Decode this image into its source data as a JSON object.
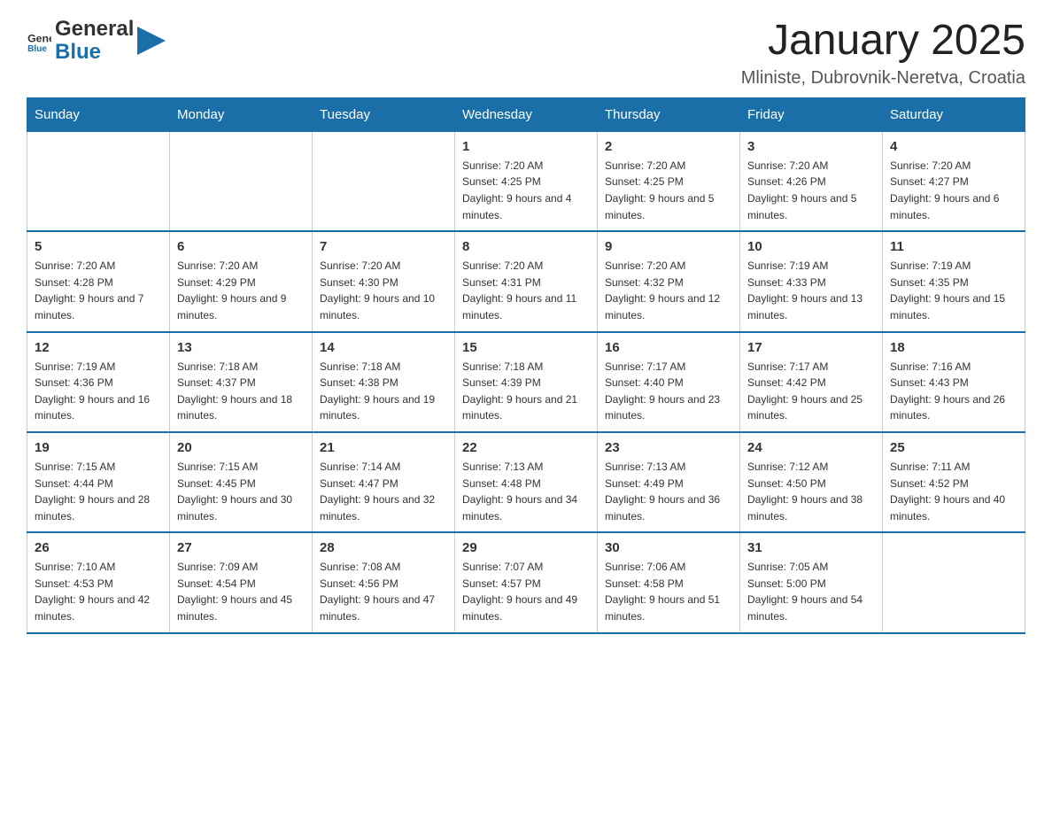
{
  "header": {
    "logo_general": "General",
    "logo_blue": "Blue",
    "month_title": "January 2025",
    "location": "Mliniste, Dubrovnik-Neretva, Croatia"
  },
  "days_of_week": [
    "Sunday",
    "Monday",
    "Tuesday",
    "Wednesday",
    "Thursday",
    "Friday",
    "Saturday"
  ],
  "weeks": [
    [
      {
        "day": "",
        "info": ""
      },
      {
        "day": "",
        "info": ""
      },
      {
        "day": "",
        "info": ""
      },
      {
        "day": "1",
        "info": "Sunrise: 7:20 AM\nSunset: 4:25 PM\nDaylight: 9 hours and 4 minutes."
      },
      {
        "day": "2",
        "info": "Sunrise: 7:20 AM\nSunset: 4:25 PM\nDaylight: 9 hours and 5 minutes."
      },
      {
        "day": "3",
        "info": "Sunrise: 7:20 AM\nSunset: 4:26 PM\nDaylight: 9 hours and 5 minutes."
      },
      {
        "day": "4",
        "info": "Sunrise: 7:20 AM\nSunset: 4:27 PM\nDaylight: 9 hours and 6 minutes."
      }
    ],
    [
      {
        "day": "5",
        "info": "Sunrise: 7:20 AM\nSunset: 4:28 PM\nDaylight: 9 hours and 7 minutes."
      },
      {
        "day": "6",
        "info": "Sunrise: 7:20 AM\nSunset: 4:29 PM\nDaylight: 9 hours and 9 minutes."
      },
      {
        "day": "7",
        "info": "Sunrise: 7:20 AM\nSunset: 4:30 PM\nDaylight: 9 hours and 10 minutes."
      },
      {
        "day": "8",
        "info": "Sunrise: 7:20 AM\nSunset: 4:31 PM\nDaylight: 9 hours and 11 minutes."
      },
      {
        "day": "9",
        "info": "Sunrise: 7:20 AM\nSunset: 4:32 PM\nDaylight: 9 hours and 12 minutes."
      },
      {
        "day": "10",
        "info": "Sunrise: 7:19 AM\nSunset: 4:33 PM\nDaylight: 9 hours and 13 minutes."
      },
      {
        "day": "11",
        "info": "Sunrise: 7:19 AM\nSunset: 4:35 PM\nDaylight: 9 hours and 15 minutes."
      }
    ],
    [
      {
        "day": "12",
        "info": "Sunrise: 7:19 AM\nSunset: 4:36 PM\nDaylight: 9 hours and 16 minutes."
      },
      {
        "day": "13",
        "info": "Sunrise: 7:18 AM\nSunset: 4:37 PM\nDaylight: 9 hours and 18 minutes."
      },
      {
        "day": "14",
        "info": "Sunrise: 7:18 AM\nSunset: 4:38 PM\nDaylight: 9 hours and 19 minutes."
      },
      {
        "day": "15",
        "info": "Sunrise: 7:18 AM\nSunset: 4:39 PM\nDaylight: 9 hours and 21 minutes."
      },
      {
        "day": "16",
        "info": "Sunrise: 7:17 AM\nSunset: 4:40 PM\nDaylight: 9 hours and 23 minutes."
      },
      {
        "day": "17",
        "info": "Sunrise: 7:17 AM\nSunset: 4:42 PM\nDaylight: 9 hours and 25 minutes."
      },
      {
        "day": "18",
        "info": "Sunrise: 7:16 AM\nSunset: 4:43 PM\nDaylight: 9 hours and 26 minutes."
      }
    ],
    [
      {
        "day": "19",
        "info": "Sunrise: 7:15 AM\nSunset: 4:44 PM\nDaylight: 9 hours and 28 minutes."
      },
      {
        "day": "20",
        "info": "Sunrise: 7:15 AM\nSunset: 4:45 PM\nDaylight: 9 hours and 30 minutes."
      },
      {
        "day": "21",
        "info": "Sunrise: 7:14 AM\nSunset: 4:47 PM\nDaylight: 9 hours and 32 minutes."
      },
      {
        "day": "22",
        "info": "Sunrise: 7:13 AM\nSunset: 4:48 PM\nDaylight: 9 hours and 34 minutes."
      },
      {
        "day": "23",
        "info": "Sunrise: 7:13 AM\nSunset: 4:49 PM\nDaylight: 9 hours and 36 minutes."
      },
      {
        "day": "24",
        "info": "Sunrise: 7:12 AM\nSunset: 4:50 PM\nDaylight: 9 hours and 38 minutes."
      },
      {
        "day": "25",
        "info": "Sunrise: 7:11 AM\nSunset: 4:52 PM\nDaylight: 9 hours and 40 minutes."
      }
    ],
    [
      {
        "day": "26",
        "info": "Sunrise: 7:10 AM\nSunset: 4:53 PM\nDaylight: 9 hours and 42 minutes."
      },
      {
        "day": "27",
        "info": "Sunrise: 7:09 AM\nSunset: 4:54 PM\nDaylight: 9 hours and 45 minutes."
      },
      {
        "day": "28",
        "info": "Sunrise: 7:08 AM\nSunset: 4:56 PM\nDaylight: 9 hours and 47 minutes."
      },
      {
        "day": "29",
        "info": "Sunrise: 7:07 AM\nSunset: 4:57 PM\nDaylight: 9 hours and 49 minutes."
      },
      {
        "day": "30",
        "info": "Sunrise: 7:06 AM\nSunset: 4:58 PM\nDaylight: 9 hours and 51 minutes."
      },
      {
        "day": "31",
        "info": "Sunrise: 7:05 AM\nSunset: 5:00 PM\nDaylight: 9 hours and 54 minutes."
      },
      {
        "day": "",
        "info": ""
      }
    ]
  ]
}
